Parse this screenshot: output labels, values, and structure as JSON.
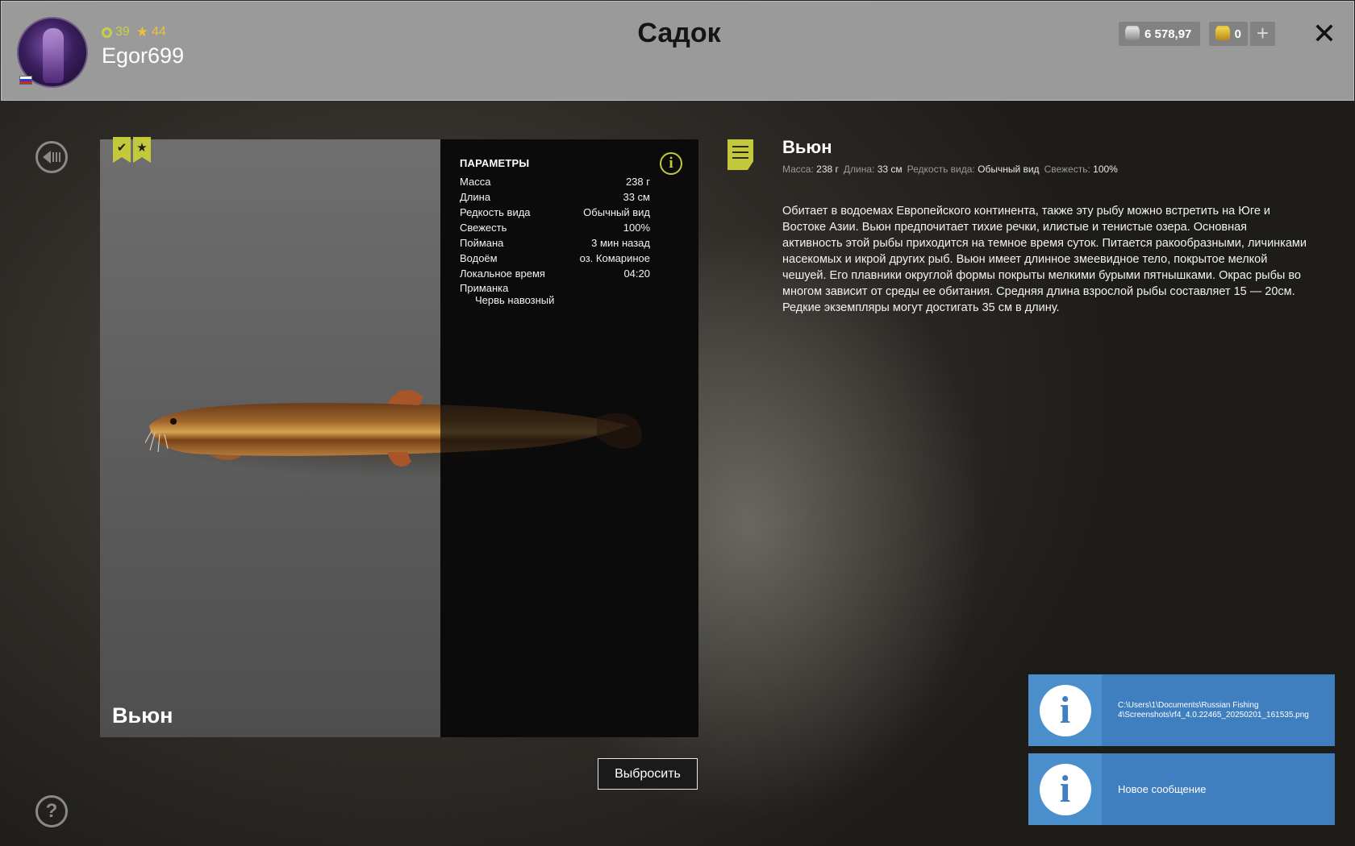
{
  "player": {
    "level": "39",
    "rank": "44",
    "username": "Egor699",
    "flag": "ru-flag"
  },
  "page": {
    "title": "Садок"
  },
  "wallet": {
    "silver": "6 578,97",
    "gold": "0",
    "add_label": "+"
  },
  "fish": {
    "name": "Вьюн",
    "params_title": "ПАРАМЕТРЫ",
    "params": [
      {
        "label": "Масса",
        "value": "238 г"
      },
      {
        "label": "Длина",
        "value": "33 см"
      },
      {
        "label": "Редкость вида",
        "value": "Обычный вид"
      },
      {
        "label": "Свежесть",
        "value": "100%"
      },
      {
        "label": "Поймана",
        "value": "3 мин назад"
      },
      {
        "label": "Водоём",
        "value": "оз. Комариное"
      },
      {
        "label": "Локальное время",
        "value": "04:20"
      }
    ],
    "bait_label": "Приманка",
    "bait_value": "Червь навозный",
    "discard_label": "Выбросить"
  },
  "description": {
    "title": "Вьюн",
    "meta": [
      {
        "label": "Масса:",
        "value": "238 г"
      },
      {
        "label": "Длина:",
        "value": "33 см"
      },
      {
        "label": "Редкость вида:",
        "value": "Обычный вид"
      },
      {
        "label": "Свежесть:",
        "value": "100%"
      }
    ],
    "text": "Обитает в водоемах Европейского континента, также эту рыбу можно встретить на Юге и Востоке Азии. Вьюн предпочитает тихие речки, илистые и тенистые озера. Основная активность этой рыбы приходится на темное время суток. Питается ракообразными, личинками насекомых и икрой других рыб. Вьюн имеет длинное змеевидное тело, покрытое мелкой чешуей. Его плавники округлой формы покрыты мелкими бурыми пятнышками. Окрас рыбы во многом зависит от среды ее обитания. Средняя длина взрослой рыбы составляет 15 — 20см. Редкие экземпляры могут достигать 35 см в длину."
  },
  "notifications": [
    {
      "text": "C:\\Users\\1\\Documents\\Russian Fishing 4\\Screenshots\\rf4_4.0.22465_20250201_161535.png"
    },
    {
      "text": "Новое сообщение"
    }
  ],
  "colors": {
    "accent": "#c3c93a",
    "header_bg": "#9a9a9a",
    "toast_bg": "#3f7fc0",
    "gold": "#e9c23a"
  }
}
